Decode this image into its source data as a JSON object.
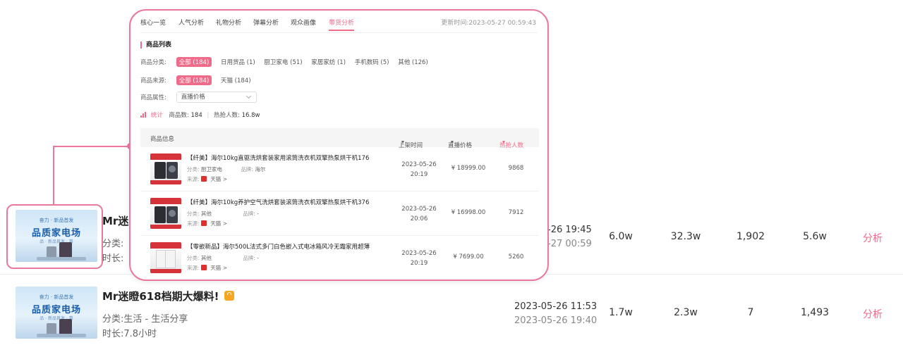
{
  "rows": [
    {
      "thumb": {
        "sub": "奋力 · 新品首发",
        "title": "品质家电场",
        "sub2": "品 · 新品首发 · 惠"
      },
      "title": "Mr迷瞪",
      "category": "分类:",
      "duration": "时长:",
      "start": "-26 19:45",
      "end": "-27 00:59",
      "m1": "6.0w",
      "m2": "32.3w",
      "m3": "1,902",
      "m4": "5.6w",
      "action": "分析"
    },
    {
      "thumb": {
        "sub": "奋力 · 新品首发",
        "title": "品质家电场",
        "sub2": "品 · 新品首发 · 惠"
      },
      "title": "Mr迷瞪618档期大爆料!",
      "category": "分类:生活 - 生活分享",
      "duration": "时长:7.8小时",
      "start": "2023-05-26 11:53",
      "end": "2023-05-26 19:40",
      "m1": "1.7w",
      "m2": "2.3w",
      "m3": "7",
      "m4": "1,493",
      "action": "分析"
    }
  ],
  "popup": {
    "tabs": [
      "核心一览",
      "人气分析",
      "礼物分析",
      "弹幕分析",
      "观众画像",
      "带货分析"
    ],
    "active_tab": "带货分析",
    "update_time": "更新时间:2023-05-27 00:59:43",
    "section_title": "商品列表",
    "filter_category": {
      "label": "商品分类:",
      "options": [
        "全部 (184)",
        "日用货品 (1)",
        "厨卫家电 (51)",
        "家居家纺 (1)",
        "手机数码 (5)",
        "其他 (126)"
      ]
    },
    "filter_source": {
      "label": "商品来源:",
      "options": [
        "全部 (184)",
        "天猫 (184)"
      ]
    },
    "filter_attr": {
      "label": "商品属性:",
      "value": "直播价格"
    },
    "stats": {
      "label": "统计",
      "count_label": "商品数:",
      "count": "184",
      "hot_label": "热抢人数:",
      "hot": "16.8w"
    },
    "table_header": {
      "info": "商品信息",
      "time": "上架时间",
      "price": "直播价格",
      "hot": "热抢人数"
    },
    "products": [
      {
        "name": "【纤美】海尔10kg直驱洗烘套装家用滚筒洗衣机双擎热泵烘干机176",
        "category_label": "分类:",
        "category": "厨卫家电",
        "brand_label": "品牌:",
        "brand": "海尔",
        "source_label": "来源:",
        "source": "天猫 >",
        "date": "2023-05-26",
        "time": "20:19",
        "price": "¥ 18999.00",
        "hot": "9868"
      },
      {
        "name": "【纤美】海尔10kg养护空气洗烘套装滚筒洗衣机双擎热泵烘干机376",
        "category_label": "分类:",
        "category": "其他",
        "brand_label": "品牌:",
        "brand": "-",
        "source_label": "来源:",
        "source": "天猫 >",
        "date": "2023-05-26",
        "time": "20:06",
        "price": "¥ 16998.00",
        "hot": "7912"
      },
      {
        "name": "【零嵌新品】海尔500L法式多门白色嵌入式电冰箱风冷无霜家用超薄",
        "category_label": "分类:",
        "category": "其他",
        "brand_label": "品牌:",
        "brand": "-",
        "source_label": "来源:",
        "source": "天猫 >",
        "date": "2023-05-26",
        "time": "20:19",
        "price": "¥ 7699.00",
        "hot": "5260"
      }
    ]
  },
  "colors": {
    "accent": "#ef6b8a",
    "highlight_border": "#e8799a"
  }
}
